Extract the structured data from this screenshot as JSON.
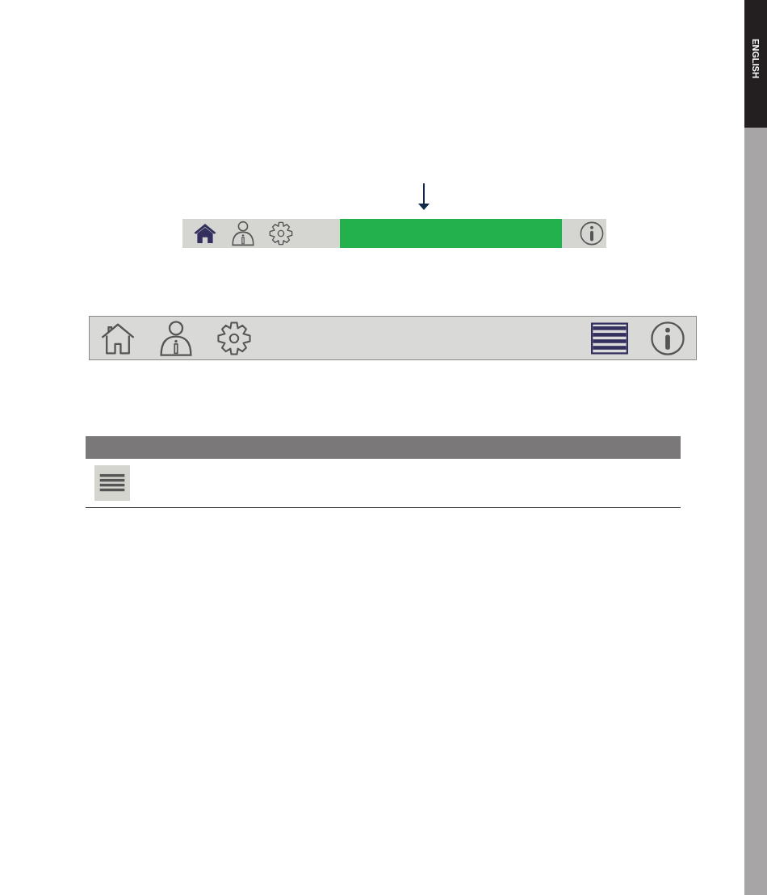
{
  "side_tab": {
    "label": "ENGLISH"
  },
  "toolbar_compact": {
    "buttons": [
      {
        "kind": "home",
        "selected": true
      },
      {
        "kind": "user",
        "selected": false
      },
      {
        "kind": "settings",
        "selected": false
      },
      {
        "kind": "status"
      },
      {
        "kind": "info",
        "selected": false
      }
    ]
  },
  "toolbar_full": {
    "buttons": [
      {
        "kind": "home",
        "selected": false
      },
      {
        "kind": "user",
        "selected": false
      },
      {
        "kind": "settings",
        "selected": false
      },
      {
        "kind": "spacer"
      },
      {
        "kind": "menu",
        "selected": true
      },
      {
        "kind": "info",
        "selected": false
      }
    ]
  },
  "table": {
    "rows": [
      {
        "kind": "menu"
      }
    ]
  }
}
